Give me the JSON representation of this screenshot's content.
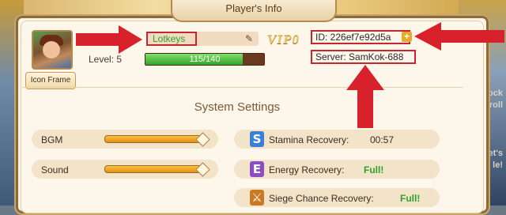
{
  "dialog": {
    "title": "Player's Info"
  },
  "profile": {
    "name": "Lotkeys",
    "level_label": "Level: 5",
    "xp_text": "115/140",
    "xp_fraction": 0.82,
    "icon_frame_label": "Icon Frame",
    "vip_label": "VIP0",
    "id_label": "ID: 226ef7e92d5a",
    "server_label": "Server: SamKok-688"
  },
  "settings": {
    "title": "System Settings",
    "sliders": [
      {
        "label": "BGM",
        "level": 1.0
      },
      {
        "label": "Sound",
        "level": 1.0
      }
    ]
  },
  "stats": [
    {
      "icon": "stamina-s-icon",
      "glyph": "S",
      "label": "Stamina Recovery:",
      "value": "00:57",
      "color": "#3b7fd6"
    },
    {
      "icon": "energy-e-icon",
      "glyph": "E",
      "label": "Energy Recovery:",
      "value": "Full!",
      "color": "#8a4fc2"
    },
    {
      "icon": "siege-icon",
      "glyph": "⚔",
      "label": "Siege Chance Recovery:",
      "value": "Full!",
      "color": "#c77a22"
    }
  ],
  "background_right": {
    "line1": "unlock",
    "line2": "or Scroll",
    "line3": "d, let's",
    "line4": "le!"
  },
  "colors": {
    "highlight": "#c7262e",
    "full": "#2ea12e",
    "name": "#2ea12e"
  }
}
